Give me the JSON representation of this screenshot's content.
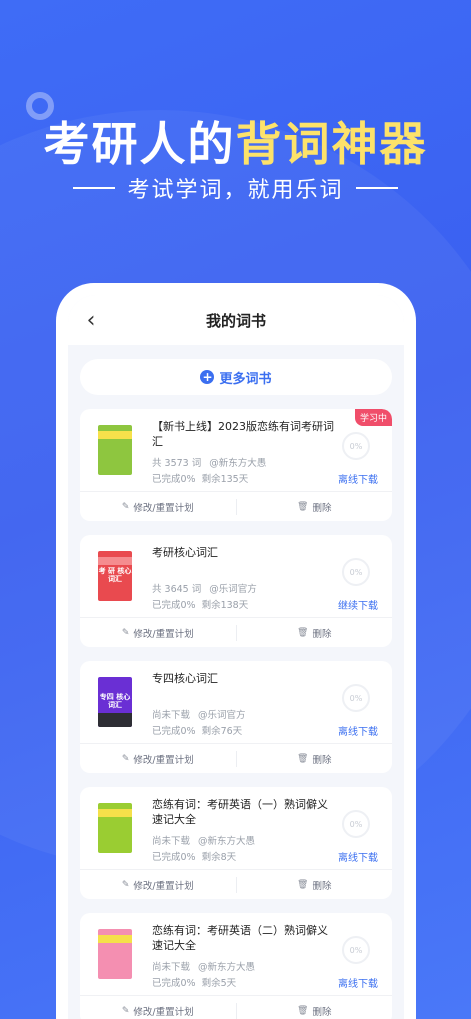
{
  "banner": {
    "headline_white": "考研人的",
    "headline_highlight": "背词神器",
    "subline": "考试学词，就用乐词"
  },
  "nav": {
    "title": "我的词书"
  },
  "more_books": {
    "label": "更多词书"
  },
  "books": [
    {
      "title": "【新书上线】2023版恋练有词考研词汇",
      "word_count": "共 3573 词",
      "author": "@新东方大愚",
      "completed": "已完成0%",
      "remaining": "剩余135天",
      "progress": "0%",
      "download": "离线下载",
      "badge": "学习中",
      "actions": {
        "edit": "修改/重置计划",
        "delete": "删除"
      },
      "cover": {
        "bg": "#8ec63f",
        "band": "#f7e14b",
        "text": ""
      }
    },
    {
      "title": "考研核心词汇",
      "word_count": "共 3645 词",
      "author": "@乐词官方",
      "completed": "已完成0%",
      "remaining": "剩余138天",
      "progress": "0%",
      "download": "继续下载",
      "badge": "",
      "actions": {
        "edit": "修改/重置计划",
        "delete": "删除"
      },
      "cover": {
        "bg": "#e94a4f",
        "band": "#f58c8f",
        "text": "考 研 核心词汇"
      }
    },
    {
      "title": "专四核心词汇",
      "word_count": "尚未下载",
      "author": "@乐词官方",
      "completed": "已完成0%",
      "remaining": "剩余76天",
      "progress": "0%",
      "download": "离线下载",
      "badge": "",
      "actions": {
        "edit": "修改/重置计划",
        "delete": "删除"
      },
      "cover": {
        "bg": "#6a2fd4",
        "band": "#2e2e34",
        "text": "专四 核心词汇"
      }
    },
    {
      "title": "恋练有词：考研英语（一）熟词僻义速记大全",
      "word_count": "尚未下载",
      "author": "@新东方大愚",
      "completed": "已完成0%",
      "remaining": "剩余8天",
      "progress": "0%",
      "download": "离线下载",
      "badge": "",
      "actions": {
        "edit": "修改/重置计划",
        "delete": "删除"
      },
      "cover": {
        "bg": "#9acd32",
        "band": "#f5e04a",
        "text": ""
      }
    },
    {
      "title": "恋练有词：考研英语（二）熟词僻义速记大全",
      "word_count": "尚未下载",
      "author": "@新东方大愚",
      "completed": "已完成0%",
      "remaining": "剩余5天",
      "progress": "0%",
      "download": "离线下载",
      "badge": "",
      "actions": {
        "edit": "修改/重置计划",
        "delete": "删除"
      },
      "cover": {
        "bg": "#f48fb1",
        "band": "#f5e04a",
        "text": ""
      }
    }
  ]
}
